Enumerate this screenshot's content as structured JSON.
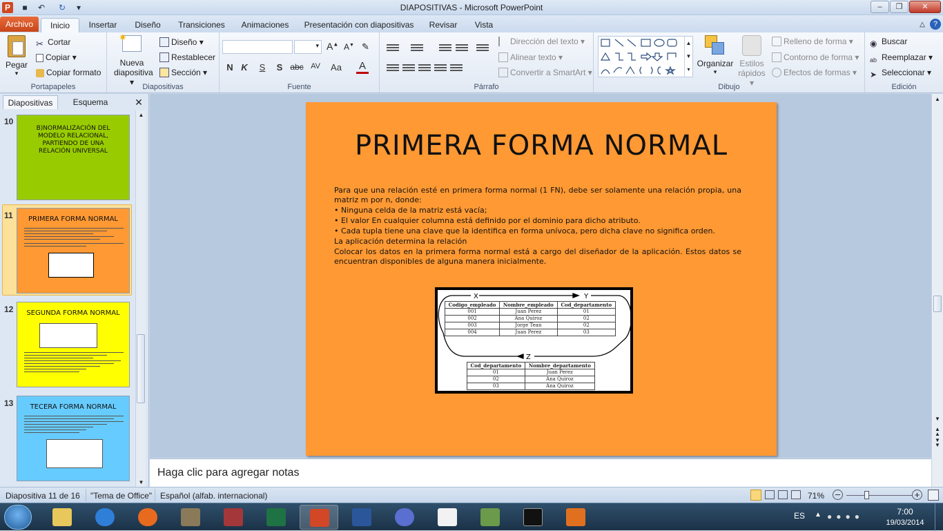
{
  "window": {
    "title": "DIAPOSITIVAS - Microsoft PowerPoint"
  },
  "tabs": [
    "Archivo",
    "Inicio",
    "Insertar",
    "Diseño",
    "Transiciones",
    "Animaciones",
    "Presentación con diapositivas",
    "Revisar",
    "Vista"
  ],
  "ribbon": {
    "portapapeles": {
      "paste": "Pegar",
      "cut": "Cortar",
      "copy": "Copiar",
      "format": "Copiar formato",
      "label": "Portapapeles"
    },
    "diapositivas": {
      "new": "Nueva",
      "new2": "diapositiva",
      "layout": "Diseño",
      "reset": "Restablecer",
      "section": "Sección",
      "label": "Diapositivas"
    },
    "fuente": {
      "bold": "N",
      "italic": "K",
      "underline": "S",
      "shadow": "S",
      "strike": "abc",
      "spacing": "AV",
      "case": "Aa",
      "color": "A",
      "label": "Fuente"
    },
    "parrafo": {
      "direction": "Dirección del texto",
      "align": "Alinear texto",
      "smartart": "Convertir a SmartArt",
      "label": "Párrafo"
    },
    "dibujo": {
      "arrange": "Organizar",
      "styles1": "Estilos",
      "styles2": "rápidos",
      "fill": "Relleno de forma",
      "outline": "Contorno de forma",
      "effects": "Efectos de formas",
      "label": "Dibujo"
    },
    "edicion": {
      "find": "Buscar",
      "replace": "Reemplazar",
      "select": "Seleccionar",
      "label": "Edición"
    }
  },
  "panel": {
    "tab_slides": "Diapositivas",
    "tab_outline": "Esquema"
  },
  "slides": [
    {
      "num": "10",
      "title": "B)NORMALIZACIÓN DEL MODELO RELACIONAL, PARTIENDO DE UNA RELACIÓN UNIVERSAL",
      "bg": "#99cc00"
    },
    {
      "num": "11",
      "title": "PRIMERA FORMA  NORMAL",
      "bg": "#ff9933"
    },
    {
      "num": "12",
      "title": "SEGUNDA FORMA  NORMAL",
      "bg": "#ffff00"
    },
    {
      "num": "13",
      "title": "TECERA FORMA  NORMAL",
      "bg": "#66ccff"
    }
  ],
  "slide": {
    "title": "PRIMERA FORMA  NORMAL",
    "p1": "Para que una relación esté en primera forma normal (1 FN), debe ser solamente una relación propia, una matriz m por n, donde:",
    "b1": "• Ninguna celda de la matriz está vacía;",
    "b2": "• El valor En cualquier columna está definido por el dominio para dicho atributo.",
    "b3": "• Cada tupla tiene una clave que la identifica en forma unívoca, pero dicha clave no significa orden.",
    "p2": "La aplicación determina  la relación",
    "p3": "Colocar los datos en la primera forma normal está a cargo del diseñador de la aplicación. Estos datos se encuentran disponibles de alguna manera inicialmente.",
    "figure": {
      "label_x": "X",
      "label_y": "Y",
      "label_z": "Z",
      "t1_headers": [
        "Codigo_empleado",
        "Nombre_empleado",
        "Cod_departamento"
      ],
      "t1_rows": [
        [
          "001",
          "Juan Perez",
          "01"
        ],
        [
          "002",
          "Ana Quiroz",
          "02"
        ],
        [
          "003",
          "Jorge Tean",
          "02"
        ],
        [
          "004",
          "Juan Perez",
          "03"
        ]
      ],
      "t2_headers": [
        "Cod_departamento",
        "Nombre_departamento"
      ],
      "t2_rows": [
        [
          "01",
          "Juan Perez"
        ],
        [
          "02",
          "Ana Quiroz"
        ],
        [
          "03",
          "Ana Quiroz"
        ]
      ]
    }
  },
  "notes": {
    "placeholder": "Haga clic para agregar notas"
  },
  "status": {
    "slide": "Diapositiva 11 de 16",
    "theme": "\"Tema de Office\"",
    "lang": "Español (alfab. internacional)",
    "zoom": "71%"
  },
  "taskbar": {
    "lang": "ES",
    "time": "7:00",
    "date": "19/03/2014"
  }
}
